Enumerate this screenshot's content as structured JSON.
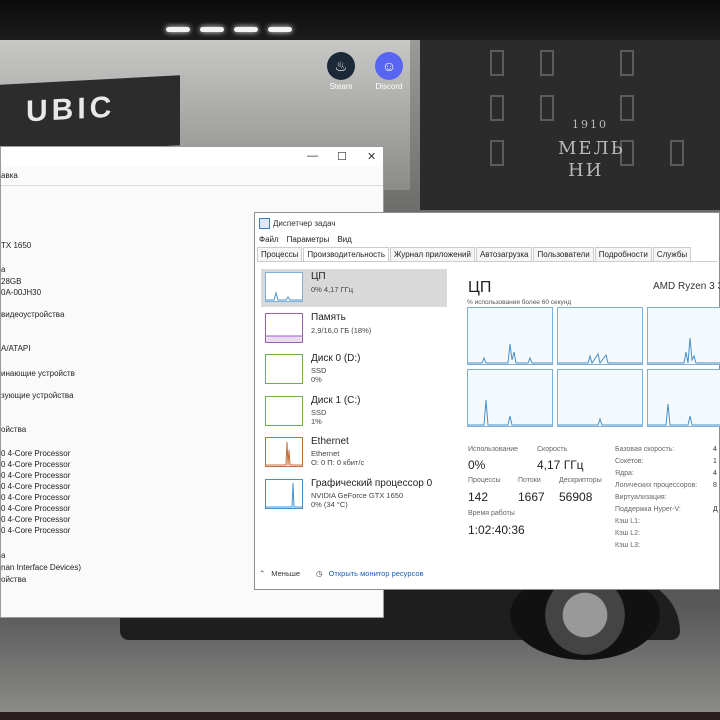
{
  "wallpaper": {
    "left_sign": "UBIC",
    "building_year": "1910",
    "building_sign_1": "МЕЛЬ",
    "building_sign_2": "НИ"
  },
  "desktop_icons": [
    {
      "name": "steam-icon",
      "label": "Steam",
      "glyph": "♨",
      "color": "#1b2838"
    },
    {
      "name": "discord-icon",
      "label": "Discord",
      "glyph": "☺",
      "color": "#5865f2"
    }
  ],
  "device_manager": {
    "menu": "авка",
    "lines": [
      "TX 1650",
      "а",
      "28GB",
      "0A-00JH30",
      "видеоустройства",
      "A/ATAPI",
      "инающие устройств",
      "зующие устройства",
      "ойства",
      "0 4-Core Processor",
      "0 4-Core Processor",
      "0 4-Core Processor",
      "0 4-Core Processor",
      "0 4-Core Processor",
      "0 4-Core Processor",
      "0 4-Core Processor",
      "0 4-Core Processor",
      "а",
      "nan Interface Devices)",
      "ойства"
    ]
  },
  "task_manager": {
    "title": "Диспетчер задач",
    "menu": [
      "Файл",
      "Параметры",
      "Вид"
    ],
    "tabs": [
      "Процессы",
      "Производительность",
      "Журнал приложений",
      "Автозагрузка",
      "Пользователи",
      "Подробности",
      "Службы"
    ],
    "active_tab": "Производительность",
    "resources": [
      {
        "name": "ЦП",
        "sub1": "0% 4,17 ГГц",
        "sub2": "",
        "border": "#7faed8"
      },
      {
        "name": "Память",
        "sub1": "2,9/16,0 ГБ (18%)",
        "sub2": "",
        "border": "#9b5fb3"
      },
      {
        "name": "Диск 0 (D:)",
        "sub1": "SSD",
        "sub2": "0%",
        "border": "#6ab04c"
      },
      {
        "name": "Диск 1 (C:)",
        "sub1": "SSD",
        "sub2": "1%",
        "border": "#6ab04c"
      },
      {
        "name": "Ethernet",
        "sub1": "Ethernet",
        "sub2": "О: 0 П: 0 кбит/с",
        "border": "#c0703a"
      },
      {
        "name": "Графический процессор 0",
        "sub1": "NVIDIA GeForce GTX 1650",
        "sub2": "0% (34 °C)",
        "border": "#4a90c8"
      }
    ],
    "cpu": {
      "heading": "ЦП",
      "model": "AMD Ryzen 3 3",
      "graph_caption": "% использования более 60 секунд",
      "usage_label": "Использование",
      "usage_value": "0%",
      "speed_label": "Скорость",
      "speed_value": "4,17 ГГц",
      "processes_label": "Процессы",
      "processes_value": "142",
      "threads_label": "Потоки",
      "threads_value": "1667",
      "handles_label": "Дескрипторы",
      "handles_value": "56908",
      "uptime_label": "Время работы",
      "uptime_value": "1:02:40:36",
      "side": [
        {
          "label": "Базовая скорость:",
          "value": "4"
        },
        {
          "label": "Сокетов:",
          "value": "1"
        },
        {
          "label": "Ядра:",
          "value": "4"
        },
        {
          "label": "Логических процессоров:",
          "value": "8"
        },
        {
          "label": "Виртуализация:",
          "value": ""
        },
        {
          "label": "Поддержка Hyper-V:",
          "value": "Д"
        },
        {
          "label": "Кэш L1:",
          "value": ""
        },
        {
          "label": "Кэш L2:",
          "value": ""
        },
        {
          "label": "Кэш L3:",
          "value": ""
        }
      ]
    },
    "footer": {
      "less": "Меньше",
      "monitor": "Открыть монитор ресурсов"
    }
  }
}
